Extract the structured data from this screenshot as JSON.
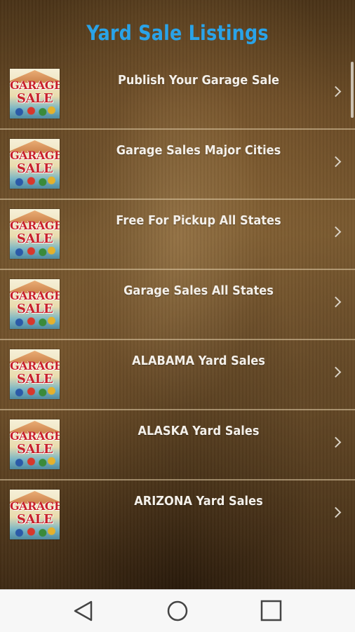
{
  "header": {
    "title": "Yard Sale Listings"
  },
  "thumbnail": {
    "word1": "GARAGE",
    "word2": "SALE"
  },
  "listings": [
    {
      "label": "Publish Your Garage Sale"
    },
    {
      "label": "Garage Sales Major Cities"
    },
    {
      "label": "Free For Pickup All States"
    },
    {
      "label": "Garage Sales All States"
    },
    {
      "label": "ALABAMA Yard Sales"
    },
    {
      "label": "ALASKA Yard Sales"
    },
    {
      "label": "ARIZONA Yard Sales"
    }
  ],
  "colors": {
    "title": "#2aa3e8",
    "item_text": "#f4f0ea",
    "navbar": "#f7f7f7"
  },
  "navbar": {
    "icons": [
      "back-icon",
      "home-icon",
      "recent-apps-icon"
    ]
  }
}
